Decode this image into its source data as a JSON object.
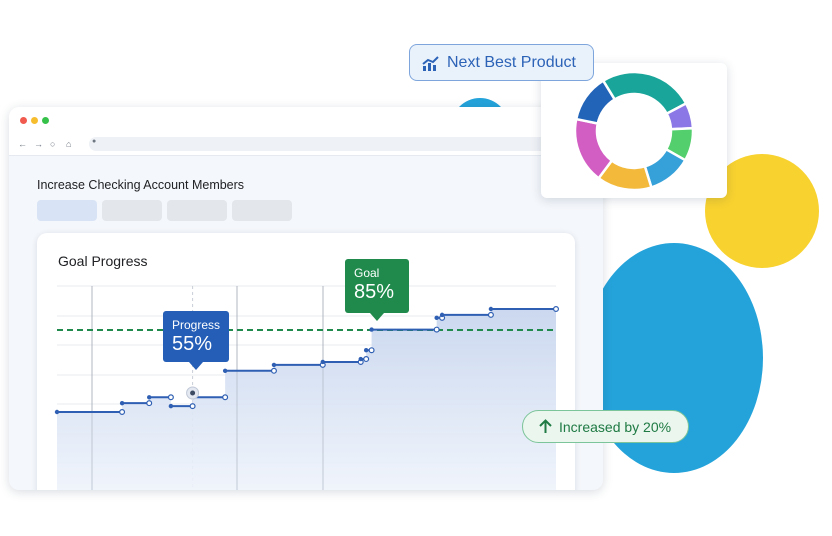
{
  "browser": {
    "traffic_lights": [
      "#f05a4f",
      "#f6bd2f",
      "#36c24a"
    ]
  },
  "page": {
    "title": "Increase Checking Account Members"
  },
  "card": {
    "title": "Goal Progress"
  },
  "progress_tooltip": {
    "label": "Progress",
    "value": "55%",
    "color": "#245eb6"
  },
  "goal_tooltip": {
    "label": "Goal",
    "value": "85%",
    "color": "#1f8a4c"
  },
  "next_best_product": {
    "label": "Next Best Product",
    "icon": "trending-chart-icon"
  },
  "increase_badge": {
    "label": "Increased by 20%",
    "icon": "arrow-up-icon"
  },
  "colors": {
    "line": "#2f5fb3",
    "area": "#d3def0",
    "goal_line": "#1f8a4c",
    "circle_blue": "#24a3da",
    "circle_yellow": "#f8d22f"
  },
  "chart_data": [
    {
      "type": "line",
      "title": "Goal Progress",
      "note": "step line with shaded area",
      "goal": 85,
      "series": [
        {
          "name": "",
          "segments": [
            [
              0,
              30
            ],
            [
              12,
              30
            ],
            [
              12,
              33
            ],
            [
              17,
              33
            ],
            [
              17,
              35
            ],
            [
              21,
              35
            ],
            [
              21,
              32
            ],
            [
              25,
              32
            ],
            [
              25,
              35
            ],
            [
              31,
              35
            ],
            [
              31,
              44
            ],
            [
              40,
              44
            ],
            [
              40,
              46
            ],
            [
              49,
              46
            ],
            [
              49,
              47
            ],
            [
              56,
              47
            ],
            [
              56,
              48
            ],
            [
              57,
              48
            ],
            [
              57,
              51
            ],
            [
              58,
              51
            ],
            [
              58,
              58
            ],
            [
              70,
              58
            ],
            [
              70,
              62
            ],
            [
              71,
              62
            ],
            [
              71,
              63
            ],
            [
              80,
              63
            ],
            [
              80,
              65
            ],
            [
              92,
              65
            ]
          ]
        }
      ],
      "highlight_point": {
        "x": 25,
        "label": "Progress",
        "value": "55%"
      },
      "grid": true
    },
    {
      "type": "pie",
      "donut": true,
      "slices": [
        {
          "color": "#1aa59a",
          "value": 26
        },
        {
          "color": "#8b78e6",
          "value": 7
        },
        {
          "color": "#54cf6e",
          "value": 9
        },
        {
          "color": "#36a0d8",
          "value": 12
        },
        {
          "color": "#f2b93b",
          "value": 15
        },
        {
          "color": "#d25ec4",
          "value": 18
        },
        {
          "color": "#2264b8",
          "value": 13
        }
      ]
    }
  ]
}
